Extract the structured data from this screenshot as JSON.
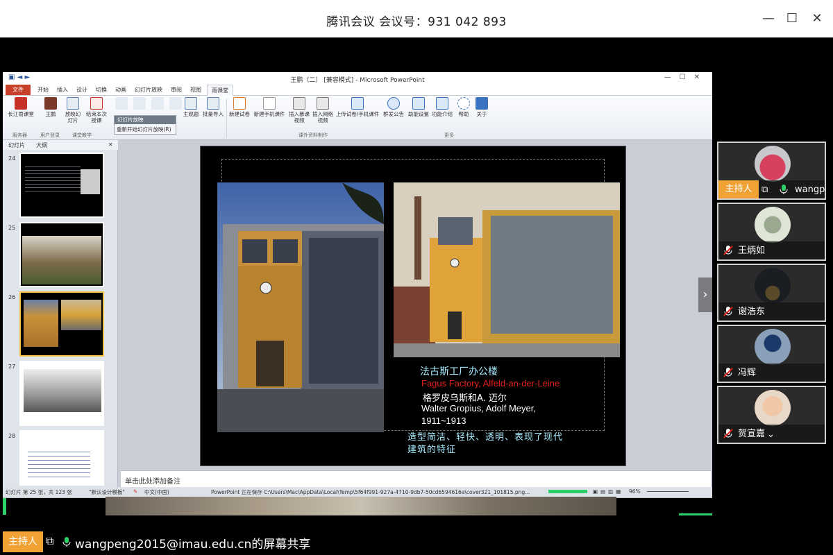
{
  "window": {
    "title": "腾讯会议 会议号：931 042 893",
    "controls": {
      "minimize": "—",
      "maximize": "☐",
      "close": "✕"
    }
  },
  "ppt": {
    "title": "王鹏（二） [兼容模式] - Microsoft PowerPoint",
    "tabs": [
      "文件",
      "开始",
      "插入",
      "设计",
      "切换",
      "动画",
      "幻灯片放映",
      "审阅",
      "视图",
      "雨课堂"
    ],
    "ribbon_buttons": [
      "长江雨课堂",
      "王鹏",
      "放映幻灯片",
      "结束本次授课",
      "新建试卷",
      "新建手机课件",
      "插入慕课视频",
      "插入网络视频",
      "上传试卷/手机课件",
      "群发公告",
      "助能设置",
      "功能介绍",
      "帮助",
      "关于",
      "主观题",
      "批量导入"
    ],
    "groups": [
      "服务器",
      "用户登录",
      "课堂教学",
      "课外资料制作",
      "更多"
    ],
    "dropdown": {
      "header": "幻灯片放映",
      "item": "重新开始幻灯片放映(R)"
    },
    "thumb_tabs": [
      "幻灯片",
      "大纲"
    ],
    "thumb_numbers": [
      "24",
      "25",
      "26",
      "27",
      "28"
    ],
    "slide": {
      "caption_title": "法古斯工厂办公楼",
      "caption_en": "Fagus Factory, Alfeld-an-der-Leine",
      "architects_cn": "格罗皮乌斯和A. 迈尔",
      "architects_en": "Walter Gropius,  Adolf Meyer,",
      "years": "1911~1913",
      "summary_1": "造型简洁、轻快、透明、表现了现代",
      "summary_2": "建筑的特征"
    },
    "notes_placeholder": "单击此处添加备注",
    "status": {
      "slide_count": "幻灯片 第 25 张，共 123 张",
      "theme": "\"默认设计模板\"",
      "lang": "中文(中国)",
      "saving": "PowerPoint 正在保存 C:\\Users\\Mac\\AppData\\Local\\Temp\\5f64f991-927a-4710-9db7-50cd6594616a\\cover321_101815.png...",
      "zoom": "96%"
    }
  },
  "participants": [
    {
      "name": "wangpeng",
      "host_label": "主持人"
    },
    {
      "name": "王炳如"
    },
    {
      "name": "谢浩东"
    },
    {
      "name": "冯辉"
    },
    {
      "name": "贺宣嘉"
    }
  ],
  "footer": {
    "host_label": "主持人",
    "share_text": "wangpeng2015@imau.edu.cn的屏幕共享"
  },
  "colors": {
    "accent": "#f0a234",
    "green": "#2ed06a",
    "red_text": "#e0201c",
    "caption_text": "#a8ecff"
  }
}
